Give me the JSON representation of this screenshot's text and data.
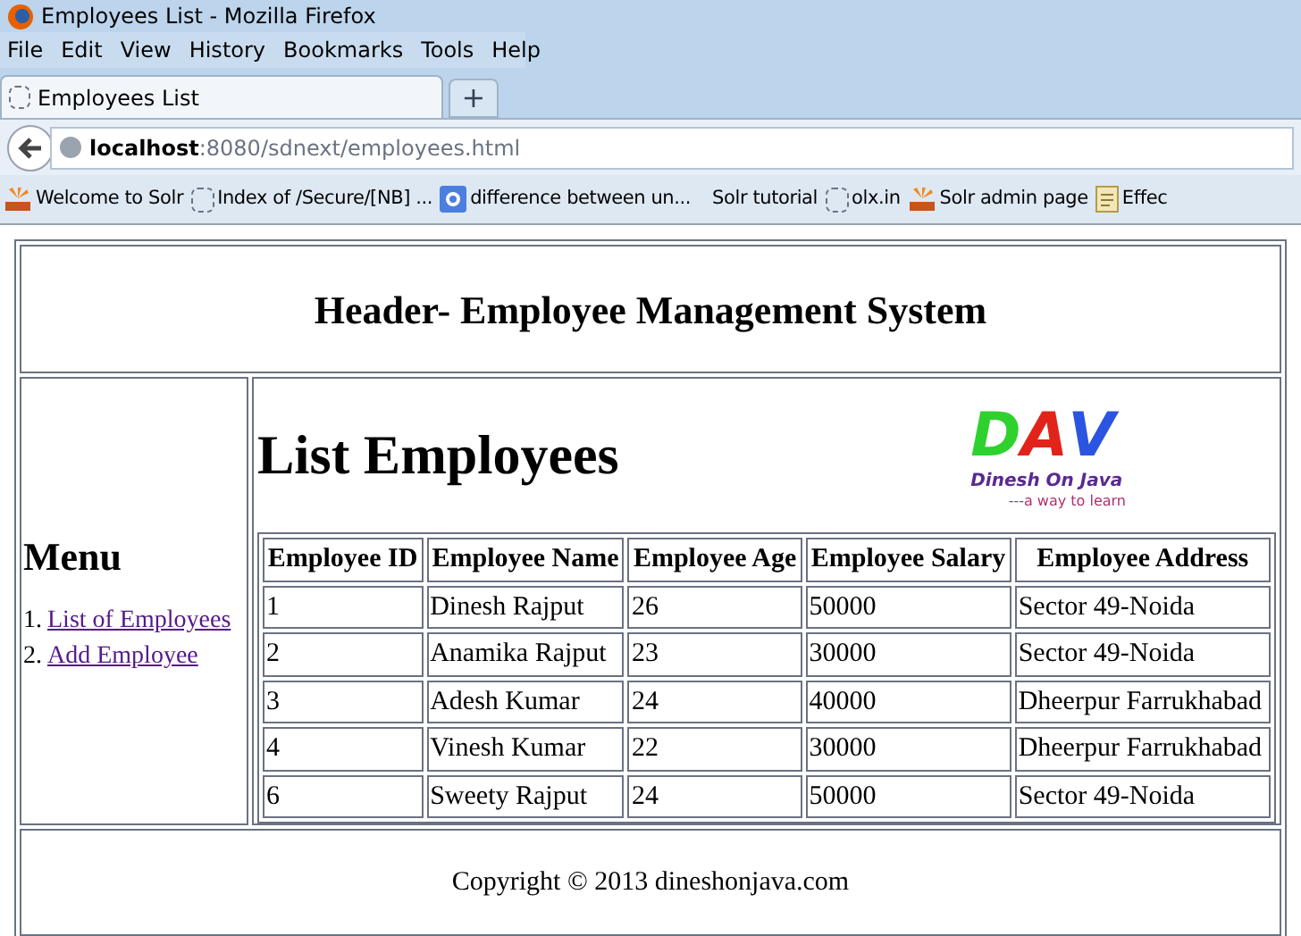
{
  "window": {
    "title": "Employees List - Mozilla Firefox"
  },
  "menu_bar": [
    "File",
    "Edit",
    "View",
    "History",
    "Bookmarks",
    "Tools",
    "Help"
  ],
  "tabs": [
    {
      "label": "Employees List",
      "selected": true
    }
  ],
  "new_tab": "+",
  "address": {
    "host": "localhost",
    "rest": ":8080/sdnext/employees.html"
  },
  "bookmarks": [
    {
      "label": "Welcome to Solr",
      "kind": "solr"
    },
    {
      "label": "Index of /Secure/[NB] ...",
      "kind": "page"
    },
    {
      "label": "difference between un...",
      "kind": "google"
    },
    {
      "label": "Solr tutorial",
      "kind": "none"
    },
    {
      "label": "olx.in",
      "kind": "page"
    },
    {
      "label": "Solr admin page",
      "kind": "solr"
    },
    {
      "label": "Effec",
      "kind": "doc"
    }
  ],
  "header": "Header- Employee Management System",
  "menu": {
    "title": "Menu",
    "items": [
      {
        "number": "1.",
        "label": "List of Employees"
      },
      {
        "number": "2.",
        "label": "Add Employee"
      }
    ]
  },
  "content": {
    "title": "List Employees",
    "logo": {
      "letters": [
        "D",
        "A",
        "V"
      ],
      "name": "Dinesh On Java",
      "tagline": "---a way to learn"
    }
  },
  "table": {
    "columns": [
      "Employee ID",
      "Employee Name",
      "Employee Age",
      "Employee Salary",
      "Employee Address"
    ],
    "rows": [
      [
        "1",
        "Dinesh Rajput",
        "26",
        "50000",
        "Sector 49-Noida"
      ],
      [
        "2",
        "Anamika Rajput",
        "23",
        "30000",
        "Sector 49-Noida"
      ],
      [
        "3",
        "Adesh Kumar",
        "24",
        "40000",
        "Dheerpur Farrukhabad"
      ],
      [
        "4",
        "Vinesh Kumar",
        "22",
        "30000",
        "Dheerpur Farrukhabad"
      ],
      [
        "6",
        "Sweety Rajput",
        "24",
        "50000",
        "Sector 49-Noida"
      ]
    ]
  },
  "footer": "Copyright © 2013 dineshonjava.com"
}
